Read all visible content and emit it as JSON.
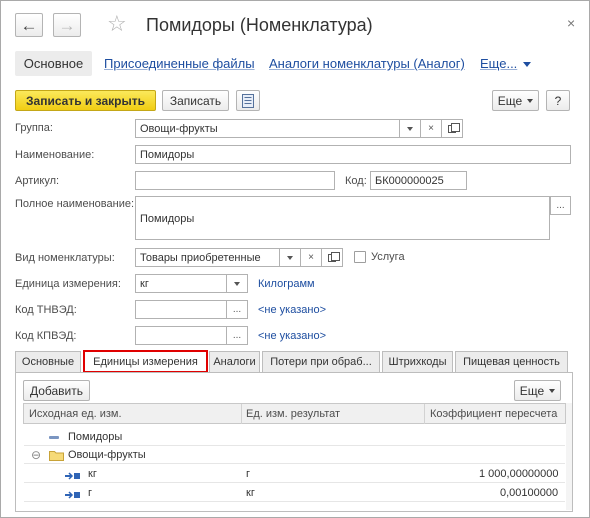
{
  "window": {
    "title": "Помидоры (Номенклатура)",
    "close_glyph": "×"
  },
  "nav": {
    "back_glyph": "←",
    "forward_glyph": "→",
    "star_glyph": "☆"
  },
  "top_tabs": {
    "main": "Основное",
    "files": "Присоединенные файлы",
    "analogs": "Аналоги номенклатуры (Аналог)",
    "more": "Еще..."
  },
  "toolbar": {
    "save_close": "Записать и закрыть",
    "save": "Записать",
    "more": "Еще",
    "help": "?"
  },
  "form": {
    "group_label": "Группа:",
    "group_value": "Овощи-фрукты",
    "name_label": "Наименование:",
    "name_value": "Помидоры",
    "article_label": "Артикул:",
    "article_value": "",
    "code_label": "Код:",
    "code_value": "БК000000025",
    "full_name_label": "Полное наименование:",
    "full_name_value": "Помидоры",
    "kind_label": "Вид номенклатуры:",
    "kind_value": "Товары приобретенные",
    "service_label": "Услуга",
    "unit_label": "Единица измерения:",
    "unit_value": "кг",
    "unit_link": "Килограмм",
    "tnved_label": "Код ТНВЭД:",
    "tnved_value": "",
    "tnved_link": "<не указано>",
    "kpved_label": "Код КПВЭД:",
    "kpved_value": "",
    "kpved_link": "<не указано>",
    "dots": "...",
    "clear": "×"
  },
  "inner_tabs": [
    "Основные",
    "Единицы измерения",
    "Аналоги",
    "Потери при обраб...",
    "Штрихкоды",
    "Пищевая ценность"
  ],
  "units_tab": {
    "add_button": "Добавить",
    "more_button": "Еще",
    "columns": [
      "Исходная ед. изм.",
      "Ед. изм. результат",
      "Коэффициент пересчета"
    ],
    "tree": {
      "root": "Помидоры",
      "group": "Овощи-фрукты",
      "rows": [
        {
          "source": "кг",
          "result": "г",
          "factor": "1 000,00000000"
        },
        {
          "source": "г",
          "result": "кг",
          "factor": "0,00100000"
        }
      ]
    },
    "collapse_glyph": "⊖"
  },
  "colors": {
    "accent_yellow": "#f4d21f",
    "link_blue": "#1e4ea0",
    "active_tab_outline": "#e00000"
  }
}
